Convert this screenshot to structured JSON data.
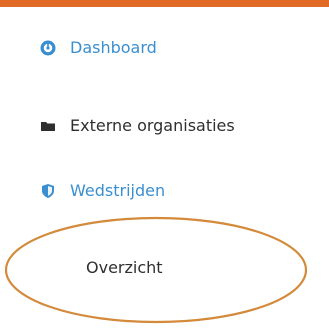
{
  "colors": {
    "accent_blue": "#3a8fd1",
    "text_dark": "#2f2f2f",
    "top_bar": "#e06a26",
    "annotation_circle": "#d38a3b"
  },
  "sidebar": {
    "items": [
      {
        "label": "Dashboard",
        "icon": "dashboard-icon",
        "color": "#3a8fd1"
      },
      {
        "label": "Externe organisaties",
        "icon": "folder-icon",
        "color": "#2f2f2f"
      },
      {
        "label": "Wedstrijden",
        "icon": "shield-icon",
        "color": "#3a8fd1"
      }
    ],
    "sub_items": [
      {
        "label": "Overzicht"
      }
    ]
  }
}
